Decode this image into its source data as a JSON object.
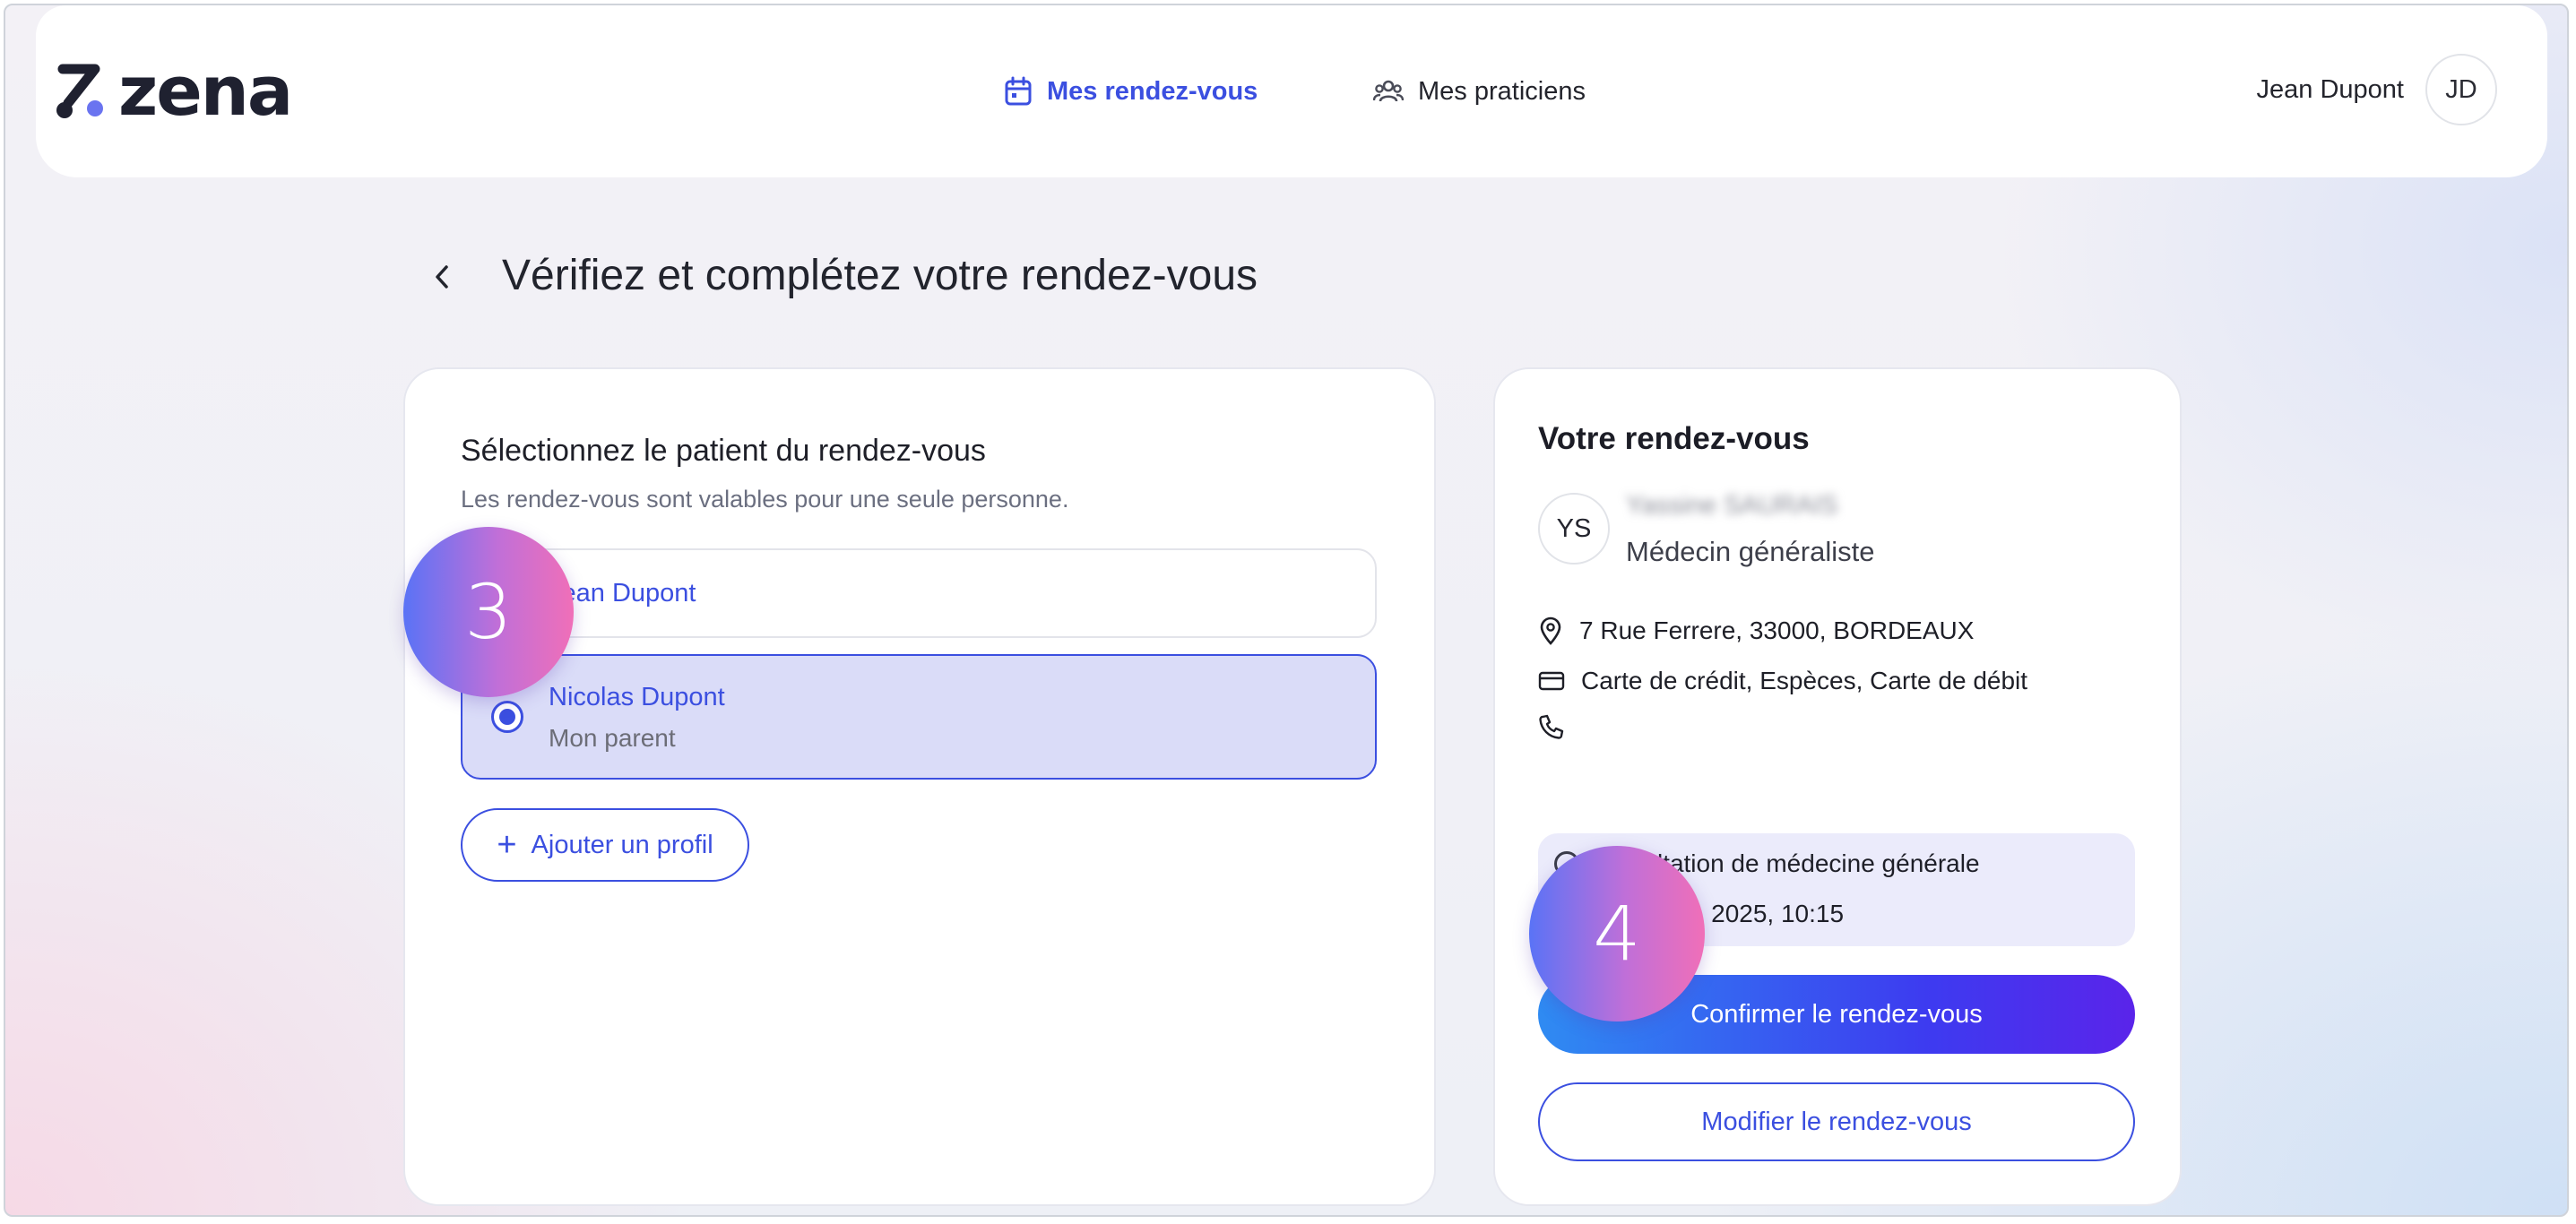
{
  "brand": {
    "name": "zena"
  },
  "nav": {
    "items": [
      {
        "label": "Mes rendez-vous",
        "icon": "calendar-icon",
        "active": true
      },
      {
        "label": "Mes praticiens",
        "icon": "users-icon",
        "active": false
      }
    ]
  },
  "user": {
    "name": "Jean Dupont",
    "initials": "JD"
  },
  "page": {
    "title": "Vérifiez et complétez votre rendez-vous"
  },
  "patient_section": {
    "title": "Sélectionnez le patient du rendez-vous",
    "subtitle": "Les rendez-vous sont valables pour une seule personne.",
    "options": [
      {
        "name": "Jean Dupont",
        "relation": "",
        "selected": false
      },
      {
        "name": "Nicolas Dupont",
        "relation": "Mon parent",
        "selected": true
      }
    ],
    "add_profile_label": "Ajouter un profil"
  },
  "appointment": {
    "title": "Votre rendez-vous",
    "doctor": {
      "initials": "YS",
      "name": "Yassine SAURAIS",
      "specialty": "Médecin généraliste"
    },
    "address": "7 Rue Ferrere, 33000, BORDEAUX",
    "payment": "Carte de crédit, Espèces, Carte de débit",
    "phone": "",
    "type": "Consultation de médecine générale",
    "datetime": "jeu. 9 janv. 2025, 10:15",
    "confirm_label": "Confirmer le rendez-vous",
    "modify_label": "Modifier le rendez-vous"
  },
  "steps": {
    "step_a": "3",
    "step_b": "4"
  },
  "colors": {
    "accent": "#3b4fe0",
    "selected_bg": "#dadcf8",
    "text": "#1e1f28"
  }
}
